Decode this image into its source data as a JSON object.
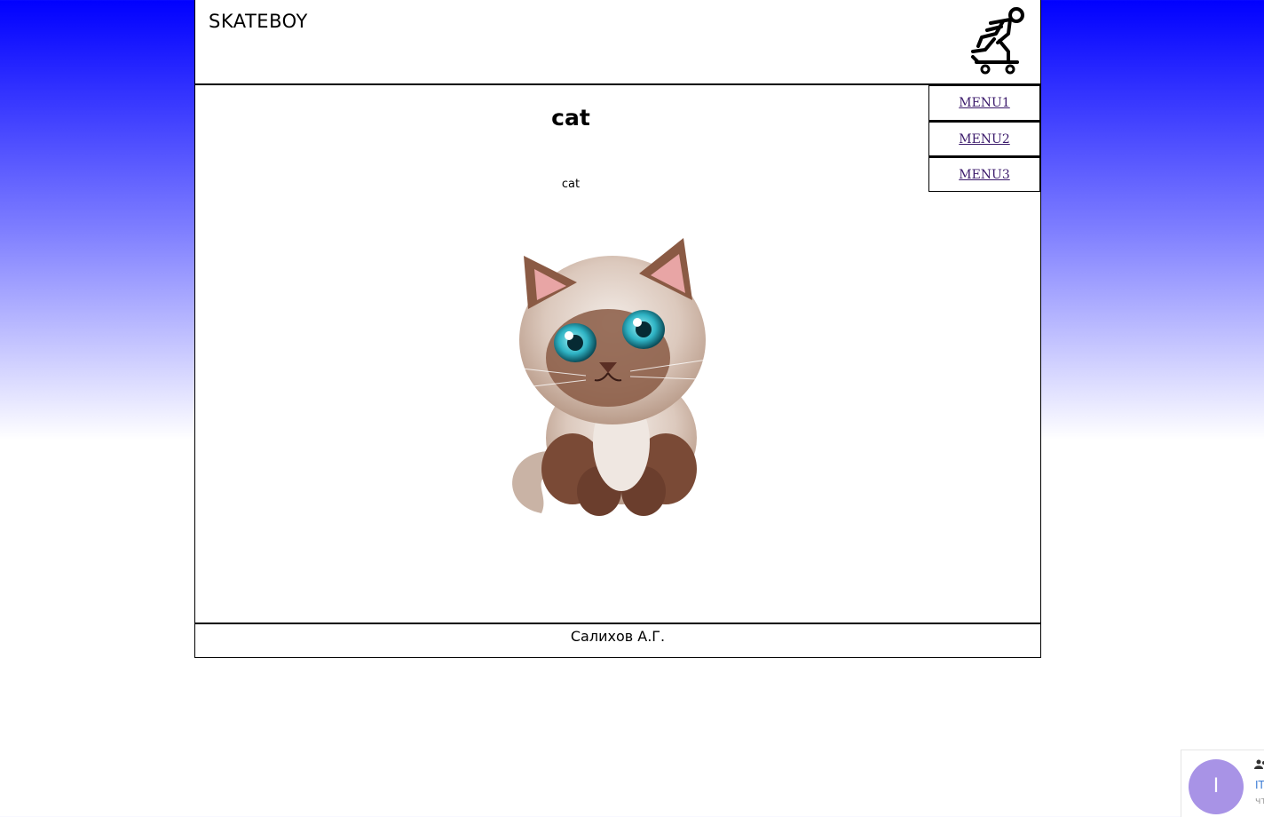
{
  "header": {
    "site_title": "SKATEBOY",
    "logo_icon": "skateboarder-icon"
  },
  "menu": {
    "items": [
      {
        "label": "MENU1"
      },
      {
        "label": "MENU2"
      },
      {
        "label": "MENU3"
      }
    ],
    "link_color": "#3b1a6b"
  },
  "content": {
    "title": "cat",
    "caption": "cat",
    "image_icon": "kitten-illustration"
  },
  "footer": {
    "author": "Салихов А.Г."
  },
  "chat_widget": {
    "avatar_letter": "I",
    "avatar_color": "#a893e6",
    "name_fragment": "IT",
    "sub_fragment": "чт"
  },
  "colors": {
    "background_gradient_top": "#0000ff",
    "background_gradient_bottom": "#ffffff"
  }
}
